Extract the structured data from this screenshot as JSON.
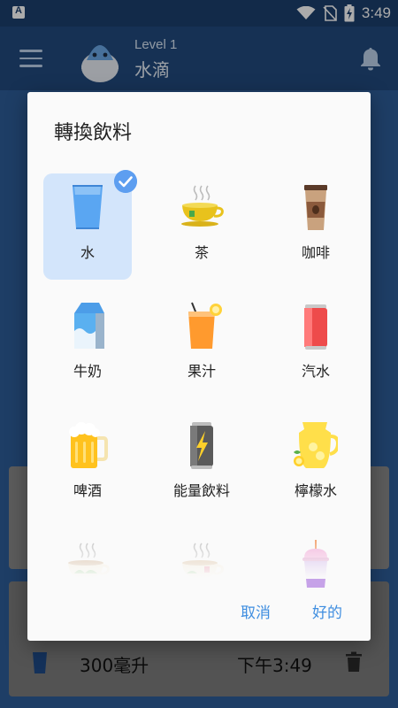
{
  "status_bar": {
    "time": "3:49"
  },
  "app_bar": {
    "level": "Level 1",
    "name": "水滴"
  },
  "record": {
    "amount": "300毫升",
    "time": "下午3:49"
  },
  "dialog": {
    "title": "轉換飲料",
    "drinks": [
      {
        "label": "水",
        "icon": "water-glass-icon",
        "selected": true
      },
      {
        "label": "茶",
        "icon": "tea-cup-icon",
        "selected": false
      },
      {
        "label": "咖啡",
        "icon": "coffee-cup-icon",
        "selected": false
      },
      {
        "label": "牛奶",
        "icon": "milk-carton-icon",
        "selected": false
      },
      {
        "label": "果汁",
        "icon": "juice-glass-icon",
        "selected": false
      },
      {
        "label": "汽水",
        "icon": "soda-can-icon",
        "selected": false
      },
      {
        "label": "啤酒",
        "icon": "beer-mug-icon",
        "selected": false
      },
      {
        "label": "能量飲料",
        "icon": "energy-drink-icon",
        "selected": false
      },
      {
        "label": "檸檬水",
        "icon": "lemonade-pitcher-icon",
        "selected": false
      }
    ],
    "cancel_label": "取消",
    "ok_label": "好的"
  },
  "colors": {
    "accent": "#3f8ee0",
    "selected_bg": "#d3e5fb",
    "check": "#5d9ef0"
  }
}
